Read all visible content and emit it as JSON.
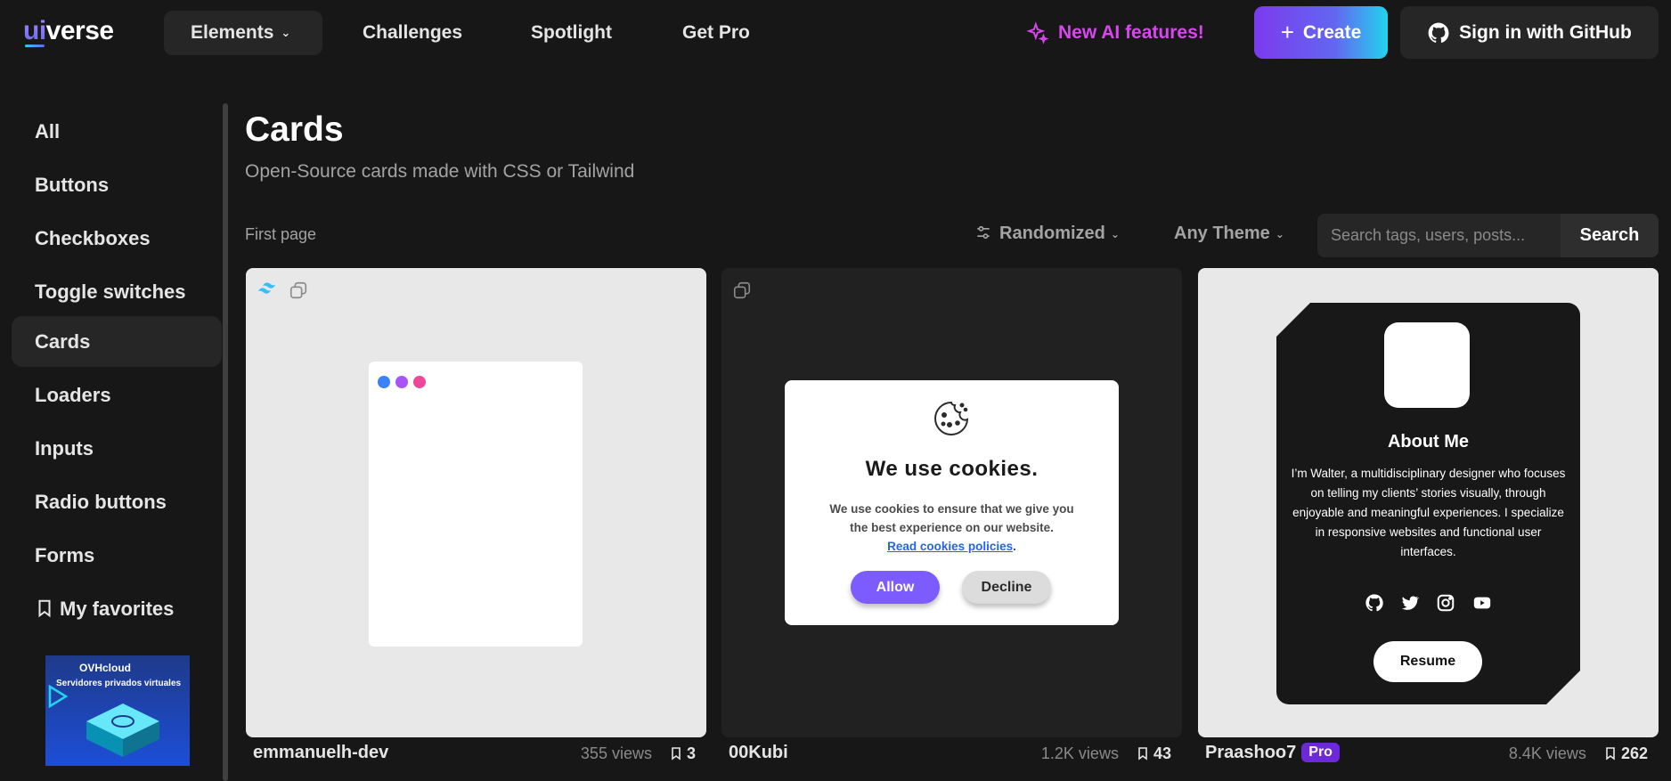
{
  "header": {
    "logo_ui": "ui",
    "logo_rest": "verse",
    "nav": {
      "elements": "Elements",
      "challenges": "Challenges",
      "spotlight": "Spotlight",
      "get_pro": "Get Pro"
    },
    "ai_link": "New AI features!",
    "create": "Create",
    "github": "Sign in with GitHub"
  },
  "sidebar": {
    "items": [
      {
        "label": "All"
      },
      {
        "label": "Buttons"
      },
      {
        "label": "Checkboxes"
      },
      {
        "label": "Toggle switches"
      },
      {
        "label": "Cards"
      },
      {
        "label": "Loaders"
      },
      {
        "label": "Inputs"
      },
      {
        "label": "Radio buttons"
      },
      {
        "label": "Forms"
      },
      {
        "label": "My favorites"
      }
    ],
    "active": "Cards",
    "ad": {
      "brand": "OVHcloud",
      "text": "Servidores privados virtuales"
    }
  },
  "main": {
    "title": "Cards",
    "subtitle": "Open-Source cards made with CSS or Tailwind",
    "pagination": "First page",
    "sort": "Randomized",
    "theme": "Any Theme",
    "search": {
      "placeholder": "Search tags, users, posts...",
      "button": "Search"
    }
  },
  "cards": [
    {
      "author": "emmanuelh-dev",
      "views": "355 views",
      "saves": "3",
      "dot_colors": [
        "#3b82f6",
        "#a855f7",
        "#ec4899"
      ]
    },
    {
      "author": "00Kubi",
      "views": "1.2K views",
      "saves": "43",
      "cookie": {
        "title": "We use cookies.",
        "text": "We use cookies to ensure that we give you the best experience on our website.",
        "link": "Read cookies policies",
        "link_suffix": ".",
        "allow": "Allow",
        "decline": "Decline"
      }
    },
    {
      "author": "Praashoo7",
      "badge": "Pro",
      "views": "8.4K views",
      "saves": "262",
      "about": {
        "title": "About Me",
        "text": "I’m Walter, a multidisciplinary designer who focuses on telling my clients’ stories visually, through enjoyable and meaningful experiences. I specialize in responsive websites and functional user interfaces.",
        "resume": "Resume"
      }
    }
  ],
  "colors": {
    "background": "#171717",
    "accent": "#7c3aed",
    "ai_link": "#d946ef",
    "cookie_allow": "#7c5cff"
  }
}
